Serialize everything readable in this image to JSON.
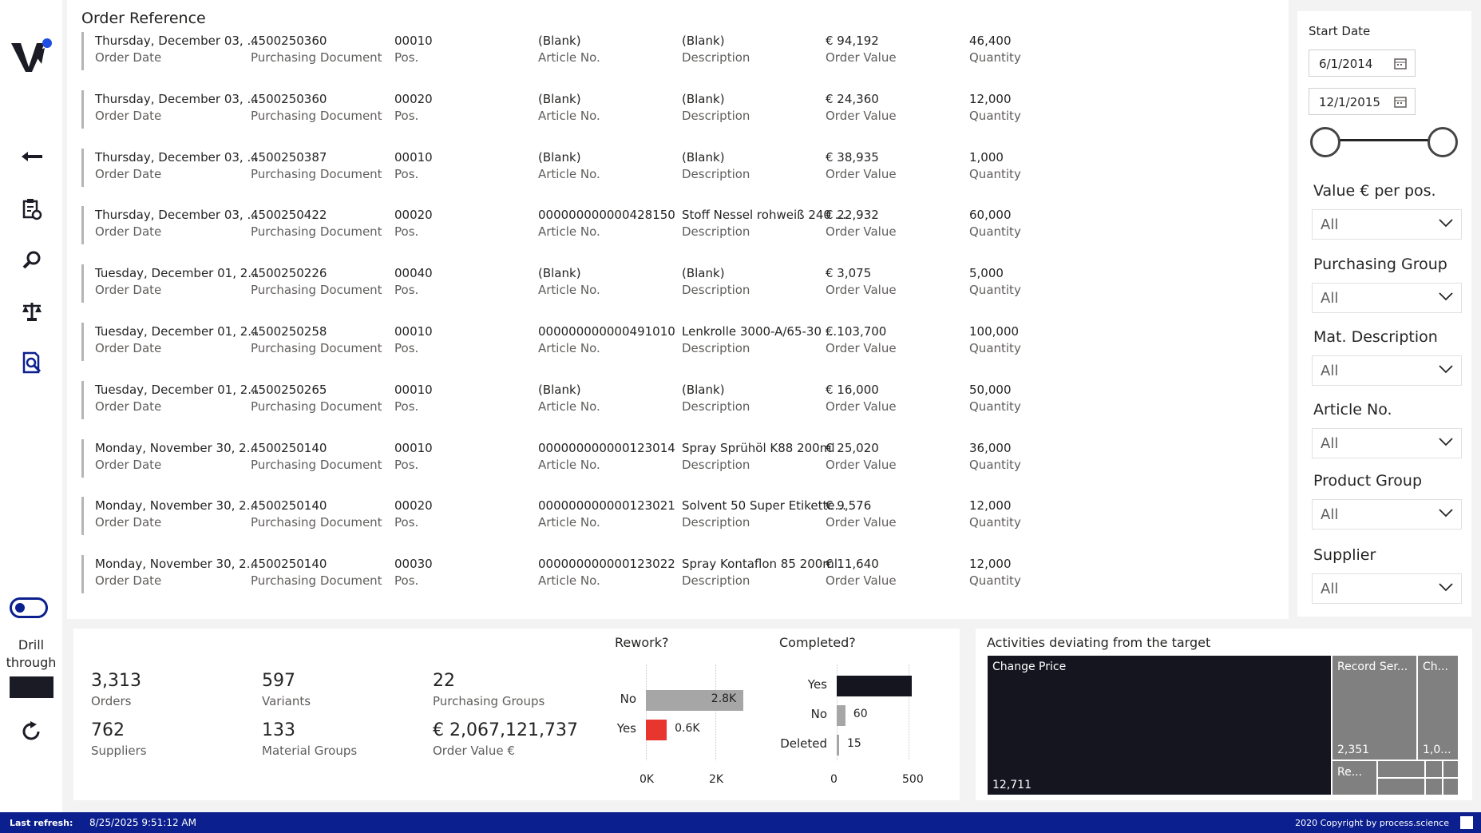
{
  "nav": {
    "icons": [
      "logo",
      "back-arrow-icon",
      "clipboard-settings-icon",
      "magnifier-icon",
      "balance-scale-icon",
      "document-search-icon",
      "toggle",
      "refresh-icon"
    ],
    "drill_through_label": "Drill through"
  },
  "table": {
    "title": "Order Reference",
    "labels": {
      "date": "Order Date",
      "doc": "Purchasing Document",
      "pos": "Pos.",
      "article": "Article No.",
      "desc": "Description",
      "value": "Order Value",
      "qty": "Quantity"
    },
    "rows": [
      {
        "date": "Thursday, December 03, ...",
        "doc": "4500250360",
        "pos": "00010",
        "article": "(Blank)",
        "desc": "(Blank)",
        "value": "€ 94,192",
        "qty": "46,400"
      },
      {
        "date": "Thursday, December 03, ...",
        "doc": "4500250360",
        "pos": "00020",
        "article": "(Blank)",
        "desc": "(Blank)",
        "value": "€ 24,360",
        "qty": "12,000"
      },
      {
        "date": "Thursday, December 03, ...",
        "doc": "4500250387",
        "pos": "00010",
        "article": "(Blank)",
        "desc": "(Blank)",
        "value": "€ 38,935",
        "qty": "1,000"
      },
      {
        "date": "Thursday, December 03, ...",
        "doc": "4500250422",
        "pos": "00020",
        "article": "000000000000428150",
        "desc": "Stoff Nessel rohweiß 240 ...",
        "value": "€ 22,932",
        "qty": "60,000"
      },
      {
        "date": "Tuesday, December 01, 2...",
        "doc": "4500250226",
        "pos": "00040",
        "article": "(Blank)",
        "desc": "(Blank)",
        "value": "€ 3,075",
        "qty": "5,000"
      },
      {
        "date": "Tuesday, December 01, 2...",
        "doc": "4500250258",
        "pos": "00010",
        "article": "000000000000491010",
        "desc": "Lenkrolle 3000-A/65-30 ...",
        "value": "€ 103,700",
        "qty": "100,000"
      },
      {
        "date": "Tuesday, December 01, 2...",
        "doc": "4500250265",
        "pos": "00010",
        "article": "(Blank)",
        "desc": "(Blank)",
        "value": "€ 16,000",
        "qty": "50,000"
      },
      {
        "date": "Monday, November 30, 2...",
        "doc": "4500250140",
        "pos": "00010",
        "article": "000000000000123014",
        "desc": "Spray Sprühöl K88 200ml",
        "value": "€ 25,020",
        "qty": "36,000"
      },
      {
        "date": "Monday, November 30, 2...",
        "doc": "4500250140",
        "pos": "00020",
        "article": "000000000000123021",
        "desc": "Solvent 50 Super Etikette...",
        "value": "€ 9,576",
        "qty": "12,000"
      },
      {
        "date": "Monday, November 30, 2...",
        "doc": "4500250140",
        "pos": "00030",
        "article": "000000000000123022",
        "desc": "Spray Kontaflon 85 200ml",
        "value": "€ 11,640",
        "qty": "12,000"
      }
    ]
  },
  "filters": {
    "start_date_label": "Start Date",
    "date_from": "6/1/2014",
    "date_to": "12/1/2015",
    "slicers": [
      {
        "label": "Value € per pos.",
        "value": "All"
      },
      {
        "label": "Purchasing Group",
        "value": "All"
      },
      {
        "label": "Mat. Description",
        "value": "All"
      },
      {
        "label": "Article No.",
        "value": "All"
      },
      {
        "label": "Product Group",
        "value": "All"
      },
      {
        "label": "Supplier",
        "value": "All"
      }
    ]
  },
  "kpis": [
    {
      "value": "3,313",
      "label": "Orders"
    },
    {
      "value": "597",
      "label": "Variants"
    },
    {
      "value": "22",
      "label": "Purchasing Groups"
    },
    {
      "value": "762",
      "label": "Suppliers"
    },
    {
      "value": "133",
      "label": "Material Groups"
    },
    {
      "value": "€ 2,067,121,737",
      "label": "Order Value €"
    }
  ],
  "chart_data": [
    {
      "type": "bar",
      "orientation": "horizontal",
      "title": "Rework?",
      "categories": [
        "No",
        "Yes"
      ],
      "values": [
        2800,
        600
      ],
      "data_labels": [
        "2.8K",
        "0.6K"
      ],
      "colors": [
        "#a6a6a6",
        "#e8352e"
      ],
      "xticks": [
        "0K",
        "2K"
      ],
      "xlim": [
        0,
        2800
      ]
    },
    {
      "type": "bar",
      "orientation": "horizontal",
      "title": "Completed?",
      "categories": [
        "Yes",
        "No",
        "Deleted"
      ],
      "values": [
        520,
        60,
        15
      ],
      "data_labels": [
        "",
        "60",
        "15"
      ],
      "colors": [
        "#151520",
        "#a6a6a6",
        "#a6a6a6"
      ],
      "xticks": [
        "0",
        "500"
      ],
      "xlim": [
        0,
        500
      ]
    },
    {
      "type": "treemap",
      "title": "Activities deviating from the target",
      "items": [
        {
          "name": "Change Price",
          "value": 12711,
          "label": "12,711"
        },
        {
          "name": "Record Ser...",
          "value": 2351,
          "label": "2,351"
        },
        {
          "name": "Ch...",
          "value": 1000,
          "label": "1,0..."
        },
        {
          "name": "Re...",
          "value": 400,
          "label": ""
        }
      ],
      "colors": {
        "main": "#151520",
        "secondary": "#808080"
      }
    }
  ],
  "footer": {
    "last_refresh_label": "Last refresh:",
    "timestamp": "8/25/2025 9:51:12 AM",
    "copyright": "2020 Copyright by process.science"
  }
}
